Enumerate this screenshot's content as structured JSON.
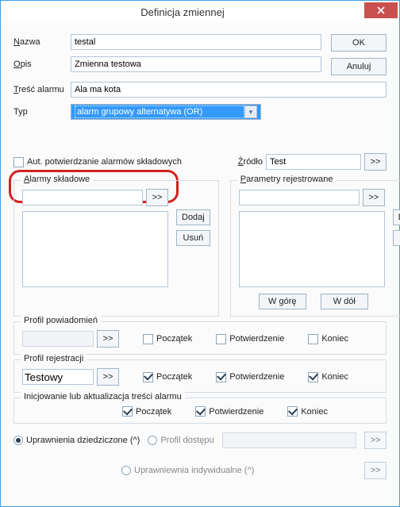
{
  "window": {
    "title": "Definicja zmiennej"
  },
  "buttons": {
    "ok": "OK",
    "cancel": "Anuluj",
    "ds": ">>",
    "add": "Dodaj",
    "remove": "Usuń",
    "up": "W górę",
    "down": "W dół"
  },
  "labels": {
    "nazwa_u": "N",
    "nazwa_rest": "azwa",
    "opis_u": "O",
    "opis_rest": "pis",
    "tresc_u": "T",
    "tresc_rest": "reść alarmu",
    "typ": "Typ",
    "auto_ack": "Aut. potwierdzanie alarmów składowych",
    "zrodlo_u": "Ź",
    "zrodlo_rest": "ródło",
    "alarmy_skladowe": "A",
    "alarmy_skladowe_rest": "larmy składowe",
    "parametry": "P",
    "parametry_rest": "arametry rejestrowane",
    "profil_pow": "Profil powiadomień",
    "profil_rej": "Profil rejestracji",
    "inicjowanie": "Inicjowanie lub aktualizacja treści alarmu",
    "poczatek": "Początek",
    "potwierdzenie": "Potwierdzenie",
    "koniec": "Koniec",
    "upr_dziedziczone": "Uprawnienia dziedziczone (^)",
    "profil_dostepu": "Profil dostępu",
    "upr_indywidualne": "Uprawniewnia indywidualne (^)"
  },
  "fields": {
    "nazwa": "testal",
    "opis": "Zmienna testowa",
    "tresc": "Ala ma kota",
    "typ": "alarm grupowy alternatywa (OR)",
    "zrodlo": "Test",
    "profil_rej": "Testowy",
    "alarmy_input": "",
    "parametry_input": ""
  },
  "checks": {
    "auto_ack": false,
    "pow_poczatek": false,
    "pow_potw": false,
    "pow_koniec": false,
    "rej_poczatek": true,
    "rej_potw": true,
    "rej_koniec": true,
    "ini_poczatek": true,
    "ini_potw": true,
    "ini_koniec": true
  },
  "radios": {
    "upr_dziedziczone": true,
    "profil_dostepu": false,
    "upr_indywidualne": false
  }
}
